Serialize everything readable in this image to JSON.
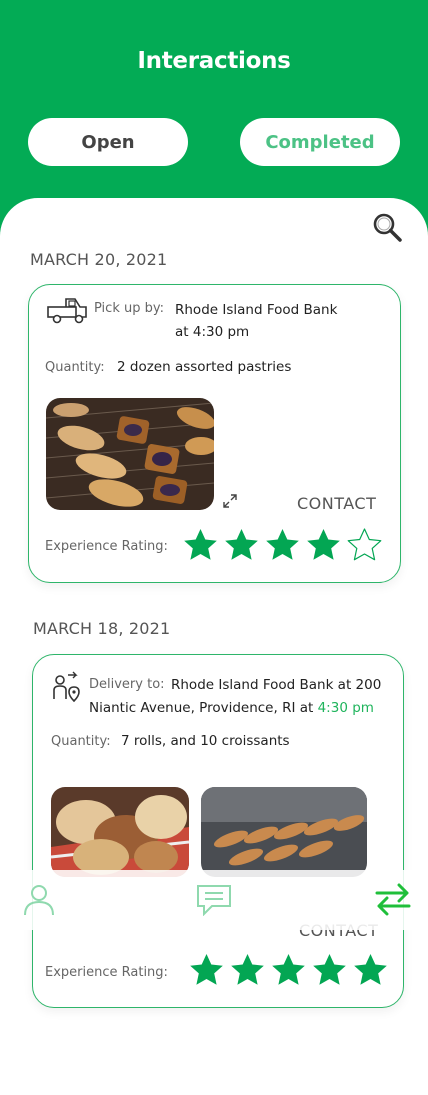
{
  "header": {
    "title": "Interactions",
    "tabs": {
      "open": "Open",
      "completed": "Completed"
    }
  },
  "search": {
    "icon": "search-icon"
  },
  "interactions": [
    {
      "date": "MARCH 20, 2021",
      "type_label": "Pick up by:",
      "org_line1": "Rhode Island Food Bank",
      "org_line2": "at 4:30 pm",
      "quantity_label": "Quantity:",
      "quantity_value": "2 dozen assorted pastries",
      "contact": "CONTACT",
      "rating_label": "Experience Rating:",
      "rating": 4,
      "rating_max": 5
    },
    {
      "date": "MARCH 18, 2021",
      "type_label": "Delivery to:",
      "org_line1": "Rhode Island Food Bank at 200",
      "org_line2_prefix": "Niantic Avenue, Providence, RI at ",
      "org_line2_time": "4:30 pm",
      "quantity_label": "Quantity:",
      "quantity_value": "7 rolls, and 10 croissants",
      "contact": "CONTACT",
      "rating_label": "Experience Rating:",
      "rating": 5,
      "rating_max": 5
    }
  ],
  "nav": {
    "items": [
      "profile-icon",
      "messages-icon",
      "transfer-icon"
    ],
    "active": "transfer-icon"
  },
  "colors": {
    "brand": "#03ab55",
    "star": "#03a653",
    "accent_text": "#4cc285"
  }
}
